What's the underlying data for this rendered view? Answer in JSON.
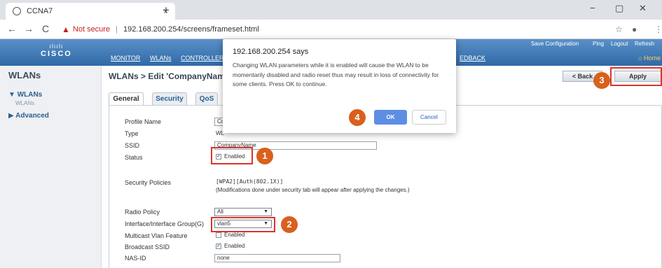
{
  "browser": {
    "tab_title": "CCNA7",
    "tab_close": "×",
    "new_tab": "+",
    "back": "←",
    "forward": "→",
    "reload": "C",
    "not_secure": "Not secure",
    "url": "192.168.200.254/screens/frameset.html",
    "star": "☆",
    "minimize": "−",
    "maximize": "▢",
    "close": "✕"
  },
  "header": {
    "logo_bars": "ılıılı",
    "logo_word": "CISCO",
    "nav": [
      "MONITOR",
      "WLANs",
      "CONTROLLER",
      "EDBACK"
    ],
    "links": [
      "Save Configuration",
      "Ping",
      "Logout",
      "Refresh"
    ],
    "home": "Home"
  },
  "sidebar": {
    "title": "WLANs",
    "items": [
      {
        "label": "WLANs",
        "arrow": "▼"
      },
      {
        "label": "Advanced",
        "arrow": "▶"
      }
    ],
    "sub": "WLANs"
  },
  "main": {
    "breadcrumb": "WLANs > Edit  'CompanyNam",
    "back_button": "< Back",
    "apply_button": "Apply",
    "tabs": [
      "General",
      "Security",
      "QoS"
    ],
    "fields": {
      "profile_name_label": "Profile Name",
      "profile_name_value": "Con",
      "type_label": "Type",
      "type_value": "WL",
      "ssid_label": "SSID",
      "ssid_value": "CompanyName",
      "status_label": "Status",
      "status_enabled": "Enabled",
      "security_label": "Security Policies",
      "security_value": "[WPA2][Auth(802.1X)]",
      "security_note": "(Modifications done under security tab will appear after applying the changes.)",
      "radio_label": "Radio Policy",
      "radio_value": "All",
      "iface_label": "Interface/Interface Group(G)",
      "iface_value": "vlan5",
      "multicast_label": "Multicast Vlan Feature",
      "multicast_enabled": "Enabled",
      "broadcast_label": "Broadcast SSID",
      "broadcast_enabled": "Enabled",
      "nasid_label": "NAS-ID",
      "nasid_value": "none"
    }
  },
  "dialog": {
    "title": "192.168.200.254 says",
    "message": "Changing WLAN parameters while it is enabled will cause the WLAN to be momentarily disabled and radio reset thus may result in loss of connectivity for some clients. Press OK to continue.",
    "ok": "OK",
    "cancel": "Cancel"
  },
  "badges": [
    "1",
    "2",
    "3",
    "4"
  ],
  "colors": {
    "badge": "#d9601e",
    "highlight": "#d9342b",
    "cisco_header": "#2f6aa6",
    "ok_button": "#5d8ee4"
  }
}
